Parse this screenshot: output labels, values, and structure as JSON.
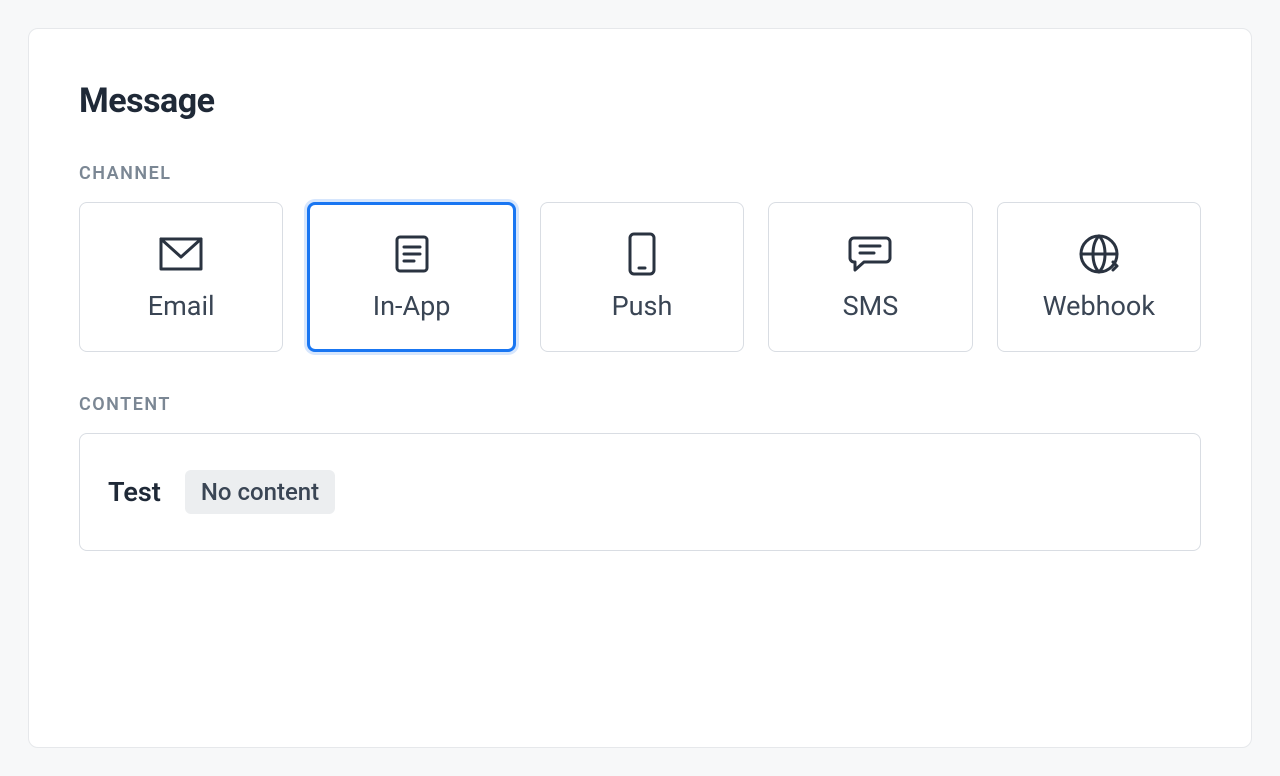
{
  "heading": "Message",
  "sectionChannel": "CHANNEL",
  "sectionContent": "CONTENT",
  "channels": {
    "email": "Email",
    "inapp": "In-App",
    "push": "Push",
    "sms": "SMS",
    "webhook": "Webhook"
  },
  "selectedChannel": "inapp",
  "content": {
    "title": "Test",
    "status": "No content"
  }
}
